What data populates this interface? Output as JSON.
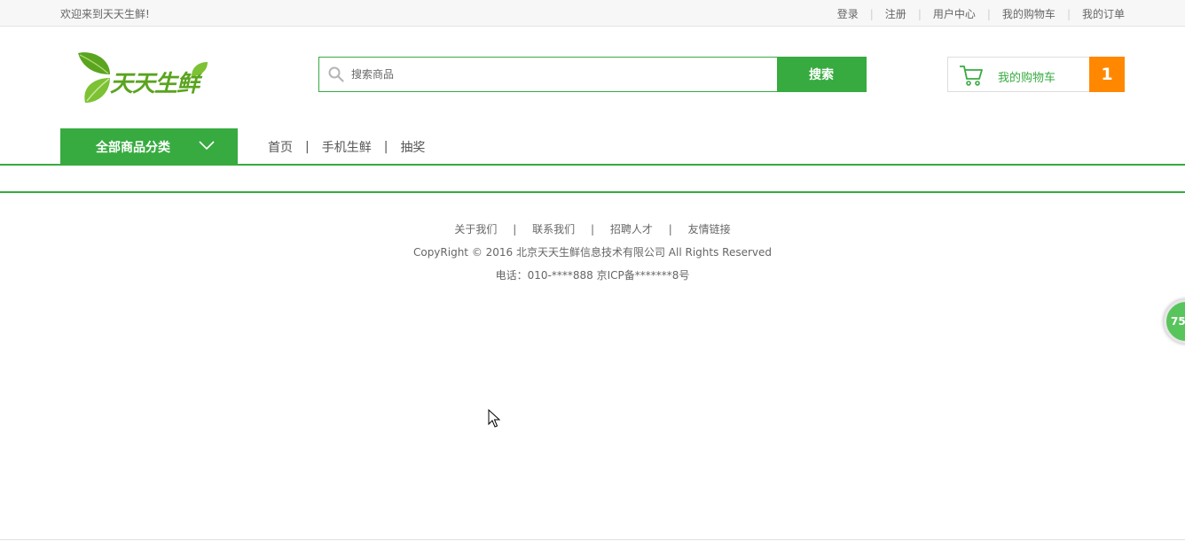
{
  "topbar": {
    "welcome": "欢迎来到天天生鲜!",
    "links": [
      "登录",
      "注册",
      "用户中心",
      "我的购物车",
      "我的订单"
    ]
  },
  "logo": {
    "text": "天天生鲜"
  },
  "search": {
    "placeholder": "搜索商品",
    "button": "搜索"
  },
  "cart": {
    "label": "我的购物车",
    "count": "1"
  },
  "nav": {
    "category_label": "全部商品分类",
    "links": [
      "首页",
      "手机生鲜",
      "抽奖"
    ]
  },
  "footer": {
    "links": [
      "关于我们",
      "联系我们",
      "招聘人才",
      "友情链接"
    ],
    "copyright": "CopyRight © 2016 北京天天生鲜信息技术有限公司 All Rights Reserved",
    "phone": "电话：010-****888 京ICP备*******8号"
  },
  "widget": {
    "value": "75"
  },
  "colors": {
    "brand_green": "#37ab40",
    "cart_count_bg": "#ff8800"
  }
}
